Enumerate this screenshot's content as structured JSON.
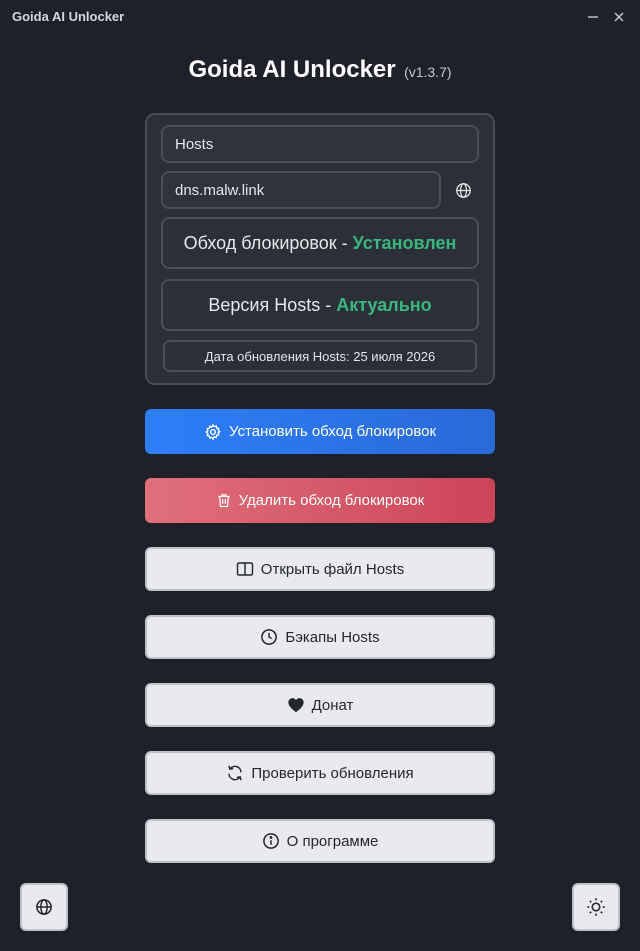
{
  "window": {
    "title": "Goida AI Unlocker",
    "minimize_glyph": "—",
    "close_glyph": "×"
  },
  "header": {
    "app_name": "Goida AI Unlocker",
    "version": "(v1.3.7)"
  },
  "panel": {
    "hosts_field": "Hosts",
    "dns_field": "dns.malw.link",
    "dns_icon": "globe-icon",
    "bypass_status": {
      "label": "Обход блокировок - ",
      "value": "Установлен"
    },
    "hosts_version": {
      "label": "Версия Hosts - ",
      "value": "Актуально"
    },
    "update_date": "Дата обновления Hosts: 25 июля 2026"
  },
  "buttons": {
    "install": {
      "label": "Установить обход блокировок",
      "icon": "gear-icon"
    },
    "remove": {
      "label": "Удалить обход блокировок",
      "icon": "trash-icon"
    },
    "open_hosts": {
      "label": "Открыть файл Hosts",
      "icon": "book-open-icon"
    },
    "backups": {
      "label": "Бэкапы Hosts",
      "icon": "clock-icon"
    },
    "donate": {
      "label": "Донат",
      "icon": "heart-icon"
    },
    "check_updates": {
      "label": "Проверить обновления",
      "icon": "refresh-icon"
    },
    "about": {
      "label": "О программе",
      "icon": "info-icon"
    }
  },
  "corner_buttons": {
    "language": {
      "icon": "globe-icon"
    },
    "theme": {
      "icon": "sun-icon"
    }
  },
  "colors": {
    "background": "#1e2129",
    "panel": "#2b2f38",
    "status_ok": "#3bb77e",
    "primary": "#2d7ff9",
    "danger": "#d9576a",
    "light_button": "#e9eaed"
  }
}
